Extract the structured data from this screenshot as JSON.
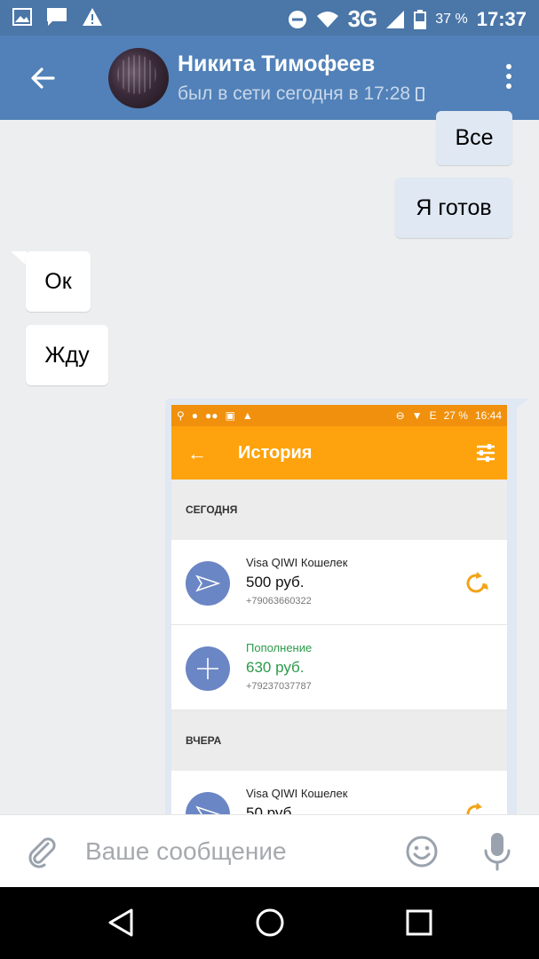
{
  "status_bar": {
    "network": "3G",
    "battery": "37 %",
    "time": "17:37"
  },
  "header": {
    "contact_name": "Никита Тимофеев",
    "last_seen": "был в сети сегодня в 17:28"
  },
  "messages": [
    {
      "direction": "out",
      "text": "Все"
    },
    {
      "direction": "out",
      "text": "Я готов"
    },
    {
      "direction": "in",
      "text": "Ок"
    },
    {
      "direction": "in",
      "text": "Жду"
    }
  ],
  "attachment_screenshot": {
    "status_bar": {
      "battery": "27 %",
      "time": "16:44"
    },
    "title": "История",
    "sections": [
      {
        "label": "СЕГОДНЯ",
        "items": [
          {
            "title": "Visa QIWI Кошелек",
            "amount": "500 руб.",
            "phone": "+79063660322",
            "type": "payment"
          },
          {
            "title": "Пополнение",
            "amount": "630 руб.",
            "phone": "+79237037787",
            "type": "topup"
          }
        ]
      },
      {
        "label": "ВЧЕРА",
        "items": [
          {
            "title": "Visa QIWI Кошелек",
            "amount": "50 руб.",
            "type": "payment"
          }
        ]
      }
    ],
    "colors": {
      "status": "#f0900c",
      "toolbar": "#fea30d",
      "icon_circle": "#6b86c4",
      "topup_green": "#2c9a4a"
    }
  },
  "input": {
    "placeholder": "Ваше сообщение"
  },
  "colors": {
    "header": "#5181b8",
    "status_bar": "#4a76a8",
    "outgoing_bubble": "#dfe8f3",
    "incoming_bubble": "#ffffff",
    "background": "#edeef0"
  },
  "icons": [
    "gallery-icon",
    "message-icon",
    "warning-icon",
    "dnd-icon",
    "wifi-icon",
    "signal-icon",
    "battery-icon",
    "back-arrow-icon",
    "more-vert-icon",
    "attach-icon",
    "emoji-icon",
    "mic-icon",
    "nav-back-icon",
    "nav-home-icon",
    "nav-recent-icon"
  ]
}
